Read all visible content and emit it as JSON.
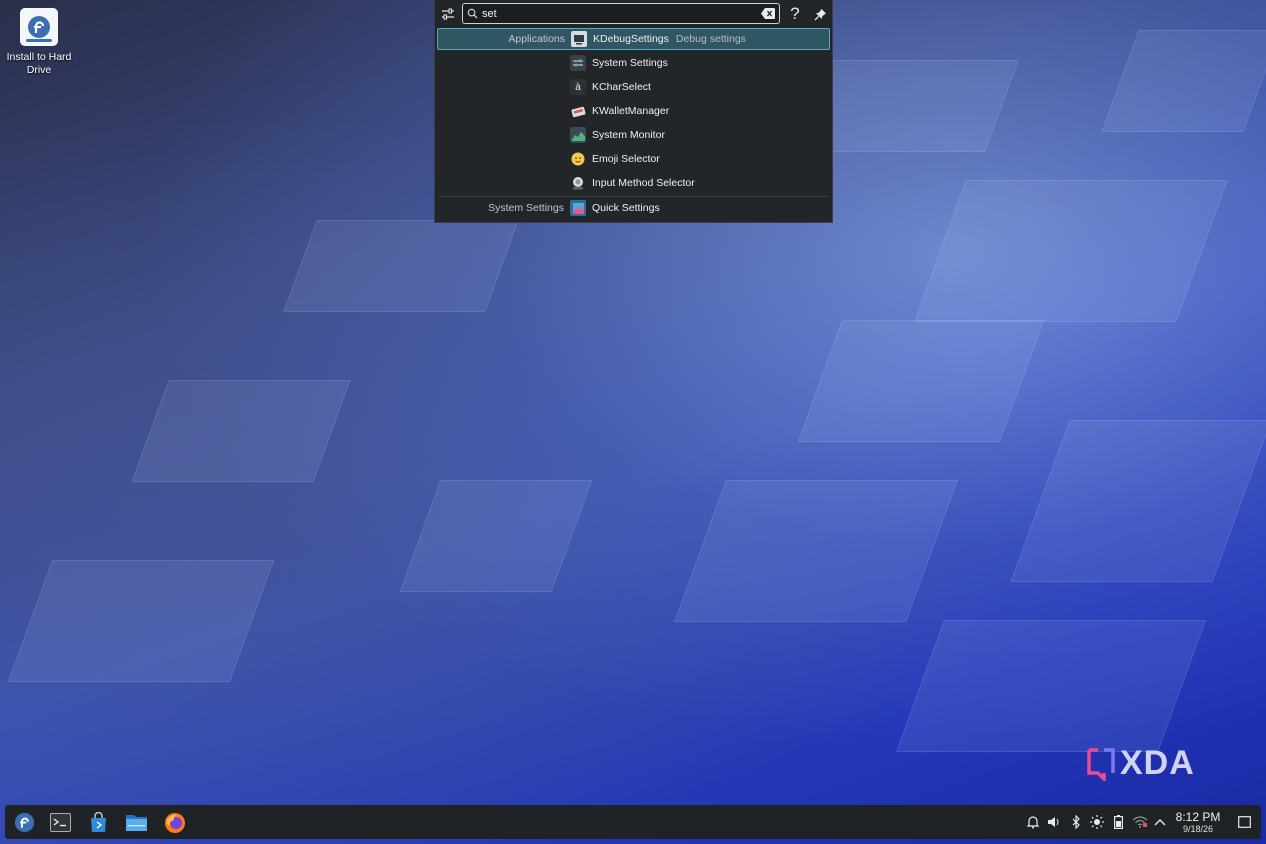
{
  "desktop": {
    "install_icon_label": "Install to Hard Drive"
  },
  "krunner": {
    "search": {
      "value": "set"
    },
    "results": [
      {
        "category": "Applications",
        "name": "KDebugSettings",
        "subtext": "Debug settings",
        "icon": "kdebugsettings-icon",
        "selected": true
      },
      {
        "category": "",
        "name": "System Settings",
        "subtext": "",
        "icon": "system-settings-icon"
      },
      {
        "category": "",
        "name": "KCharSelect",
        "subtext": "",
        "icon": "kcharselect-icon"
      },
      {
        "category": "",
        "name": "KWalletManager",
        "subtext": "",
        "icon": "kwallet-icon"
      },
      {
        "category": "",
        "name": "System Monitor",
        "subtext": "",
        "icon": "system-monitor-icon"
      },
      {
        "category": "",
        "name": "Emoji Selector",
        "subtext": "",
        "icon": "emoji-icon"
      },
      {
        "category": "",
        "name": "Input Method Selector",
        "subtext": "",
        "icon": "input-method-icon"
      },
      {
        "category": "System Settings",
        "name": "Quick Settings",
        "subtext": "",
        "icon": "quick-settings-icon"
      }
    ]
  },
  "watermark": {
    "text": "XDA"
  },
  "taskbar": {
    "apps": [
      "fedora-launcher-icon",
      "konsole-icon",
      "discover-icon",
      "dolphin-icon",
      "firefox-icon"
    ],
    "tray": [
      "notifications-icon",
      "volume-icon",
      "bluetooth-icon",
      "brightness-icon",
      "battery-icon",
      "wifi-icon",
      "expand-tray-icon"
    ],
    "clock": {
      "time": "8:12 PM",
      "date": "9/18/26"
    }
  }
}
